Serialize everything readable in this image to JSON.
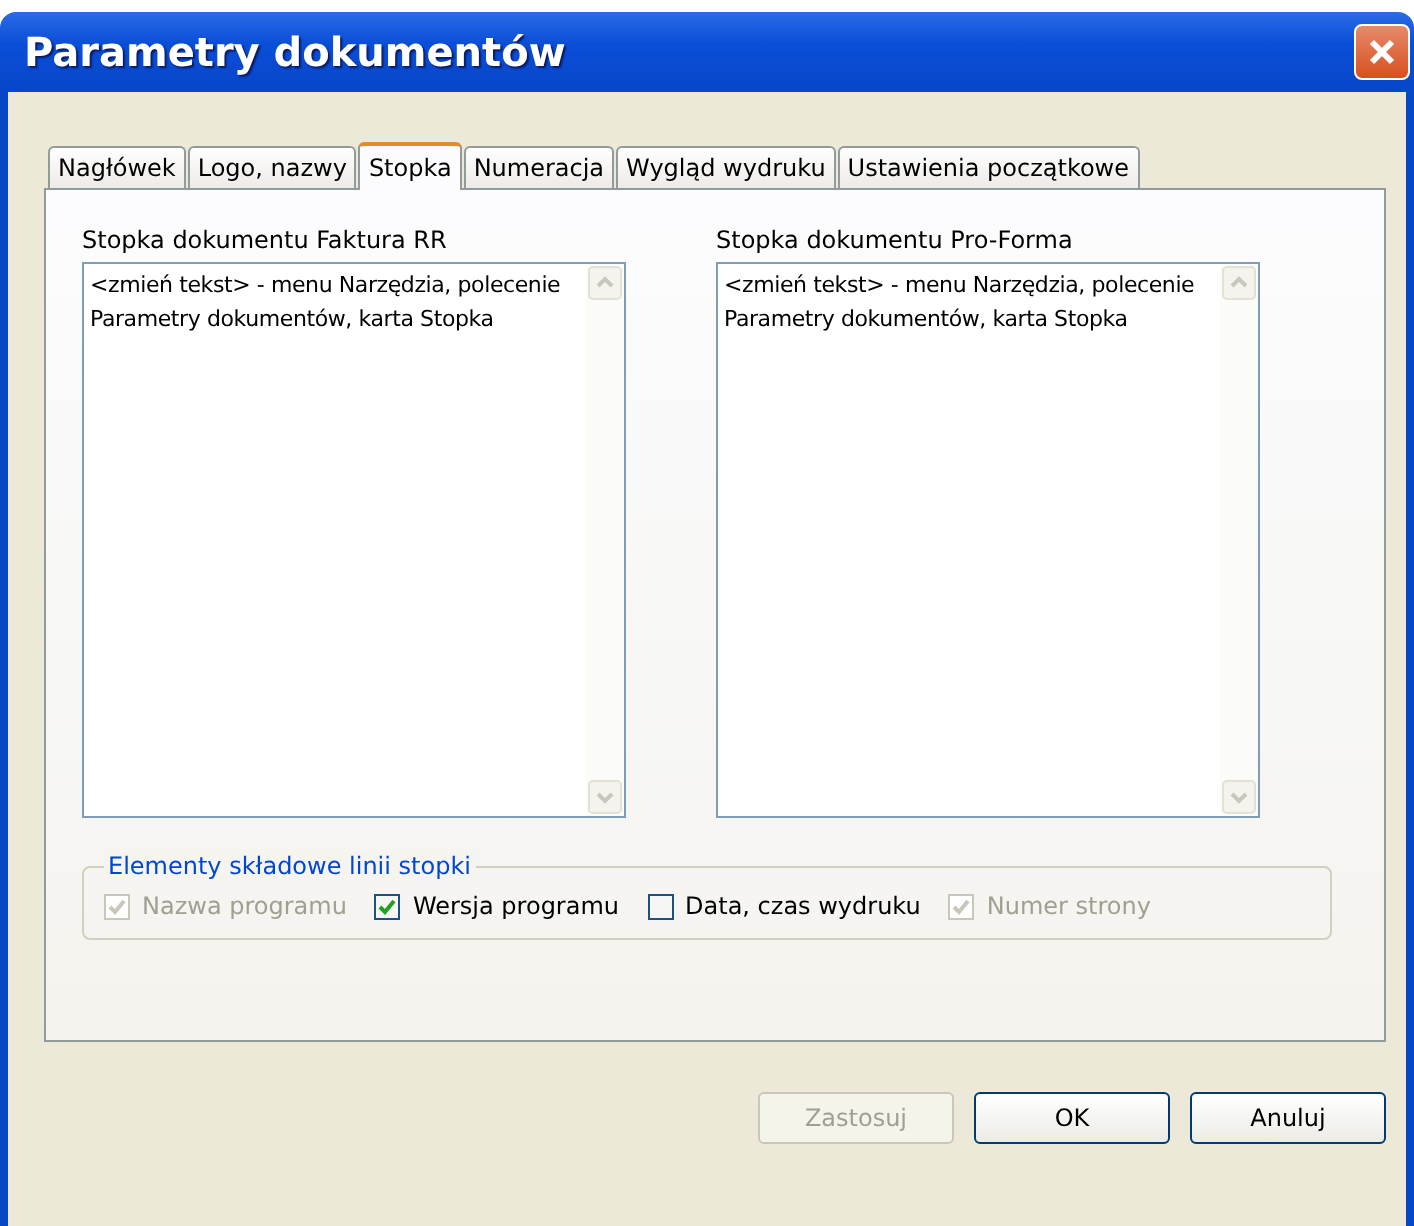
{
  "window": {
    "title": "Parametry dokumentów"
  },
  "tabs": [
    {
      "label": "Nagłówek",
      "selected": false
    },
    {
      "label": "Logo, nazwy",
      "selected": false
    },
    {
      "label": "Stopka",
      "selected": true
    },
    {
      "label": "Numeracja",
      "selected": false
    },
    {
      "label": "Wygląd wydruku",
      "selected": false
    },
    {
      "label": "Ustawienia początkowe",
      "selected": false
    }
  ],
  "footers": [
    {
      "label": "Stopka dokumentu Faktura RR",
      "value": "<zmień tekst> - menu Narzędzia, polecenie Parametry dokumentów, karta Stopka"
    },
    {
      "label": "Stopka dokumentu Pro-Forma",
      "value": "<zmień tekst> - menu Narzędzia, polecenie Parametry dokumentów, karta Stopka"
    }
  ],
  "footer_elements": {
    "title": "Elementy składowe linii stopki",
    "options": [
      {
        "label": "Nazwa programu",
        "checked": true,
        "disabled": true
      },
      {
        "label": "Wersja programu",
        "checked": true,
        "disabled": false
      },
      {
        "label": "Data, czas wydruku",
        "checked": false,
        "disabled": false
      },
      {
        "label": "Numer strony",
        "checked": true,
        "disabled": true
      }
    ]
  },
  "buttons": [
    {
      "label": "Zastosuj",
      "disabled": true
    },
    {
      "label": "OK",
      "disabled": false
    },
    {
      "label": "Anuluj",
      "disabled": false
    }
  ]
}
